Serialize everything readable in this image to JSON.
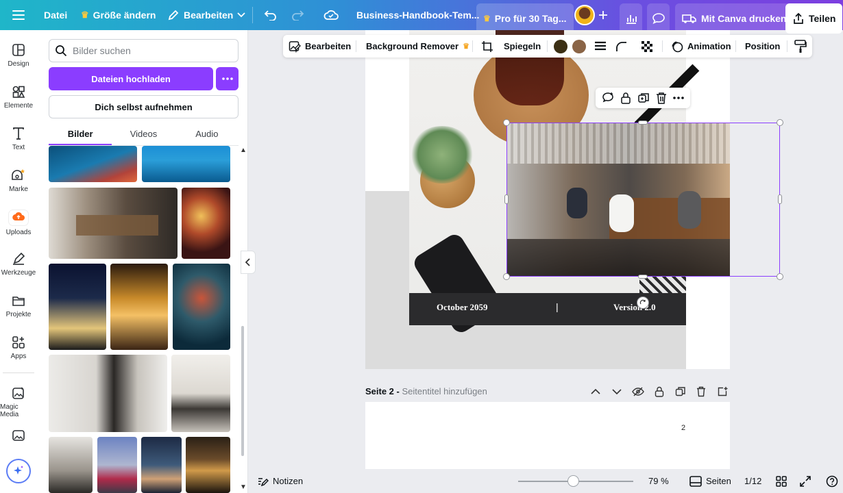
{
  "topbar": {
    "menu_label": "Datei",
    "resize_label": "Größe ändern",
    "edit_label": "Bearbeiten",
    "doc_title": "Business-Handbook-Tem...",
    "pro_label": "Pro für 30 Tag...",
    "print_label": "Mit Canva drucken",
    "share_label": "Teilen"
  },
  "rail": {
    "items": [
      {
        "label": "Design",
        "icon": "layout-icon"
      },
      {
        "label": "Elemente",
        "icon": "shapes-icon"
      },
      {
        "label": "Text",
        "icon": "text-icon"
      },
      {
        "label": "Marke",
        "icon": "brand-icon"
      },
      {
        "label": "Uploads",
        "icon": "upload-cloud-icon"
      },
      {
        "label": "Werkzeuge",
        "icon": "pen-tool-icon"
      },
      {
        "label": "Projekte",
        "icon": "folder-icon"
      },
      {
        "label": "Apps",
        "icon": "apps-icon"
      },
      {
        "label": "Magic Media",
        "icon": "magic-media-icon"
      }
    ]
  },
  "panel": {
    "search_placeholder": "Bilder suchen",
    "upload_label": "Dateien hochladen",
    "record_label": "Dich selbst aufnehmen",
    "tabs": [
      "Bilder",
      "Videos",
      "Audio"
    ],
    "active_tab": "Bilder"
  },
  "context_toolbar": {
    "edit_label": "Bearbeiten",
    "bg_remover_label": "Background Remover",
    "flip_label": "Spiegeln",
    "animation_label": "Animation",
    "position_label": "Position",
    "swatch_colors": [
      "#3b2f14",
      "#8a6446"
    ]
  },
  "canvas": {
    "footer_date": "October 2059",
    "footer_sep": "|",
    "footer_version": "Version 2.0",
    "page2_label": "Seite 2 -",
    "page2_subtitle": "Seitentitel hinzufügen",
    "page2_number": "2"
  },
  "bottombar": {
    "notes_label": "Notizen",
    "zoom": "79 %",
    "zoom_level": 0.48,
    "pages_label": "Seiten",
    "page_counter": "1/12"
  },
  "colors": {
    "accent": "#8b3dff",
    "selection": "#8b3dff"
  }
}
